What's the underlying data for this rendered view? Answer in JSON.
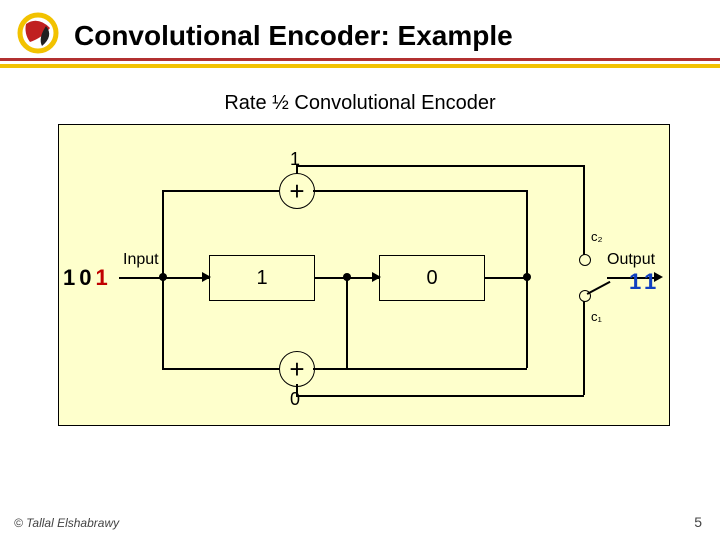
{
  "title": "Convolutional Encoder: Example",
  "subtitle": "Rate ½ Convolutional Encoder",
  "diagram": {
    "input_label": "Input",
    "output_label": "Output",
    "reg1": "1",
    "reg2": "0",
    "top_sum": "1",
    "bot_sum": "0",
    "c2": "c₂",
    "c1": "c₁",
    "plus": "+",
    "input_seq": {
      "a": "1",
      "b": "0",
      "c": "1"
    },
    "output_seq": {
      "a": "1",
      "b": "1"
    }
  },
  "footer": "© Tallal Elshabrawy",
  "page": "5"
}
